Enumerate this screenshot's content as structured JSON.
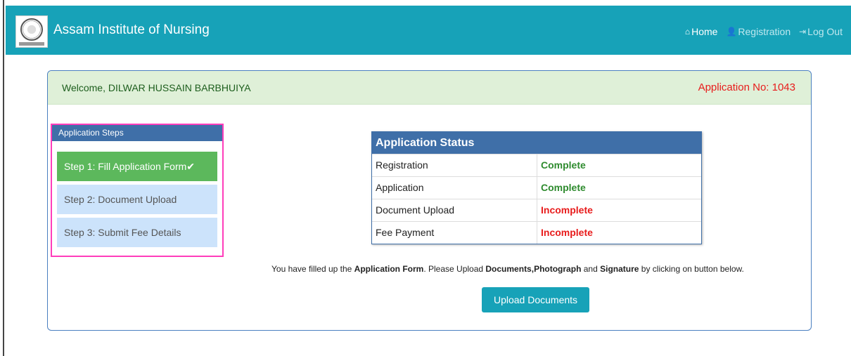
{
  "nav": {
    "brand": "Assam Institute of Nursing",
    "links": [
      {
        "label": "Home",
        "icon": "home-icon"
      },
      {
        "label": "Registration",
        "icon": "user-plus-icon"
      },
      {
        "label": "Log Out",
        "icon": "sign-out-icon"
      }
    ]
  },
  "header": {
    "welcome": "Welcome, DILWAR HUSSAIN BARBHUIYA",
    "application_no": "Application No: 1043"
  },
  "steps": {
    "title": "Application Steps",
    "items": [
      {
        "label": "Step 1: Fill Application Form",
        "done_mark": "✔"
      },
      {
        "label": "Step 2: Document Upload"
      },
      {
        "label": "Step 3: Submit Fee Details"
      }
    ]
  },
  "status": {
    "title": "Application Status",
    "rows": [
      {
        "item": "Registration",
        "value": "Complete"
      },
      {
        "item": "Application",
        "value": "Complete"
      },
      {
        "item": "Document Upload",
        "value": "Incomplete"
      },
      {
        "item": "Fee Payment",
        "value": "Incomplete"
      }
    ]
  },
  "message": {
    "part1": "You have filled up the ",
    "bold1": "Application Form",
    "part2": ". Please Upload ",
    "bold2": "Documents,Photograph",
    "part3": " and ",
    "bold3": "Signature",
    "part4": " by clicking on button below."
  },
  "upload_button": "Upload Documents",
  "colors": {
    "navbar": "#17a2b8",
    "complete": "#2e8b2e",
    "incomplete": "#e81c1c",
    "panel": "#3f6fa8"
  }
}
